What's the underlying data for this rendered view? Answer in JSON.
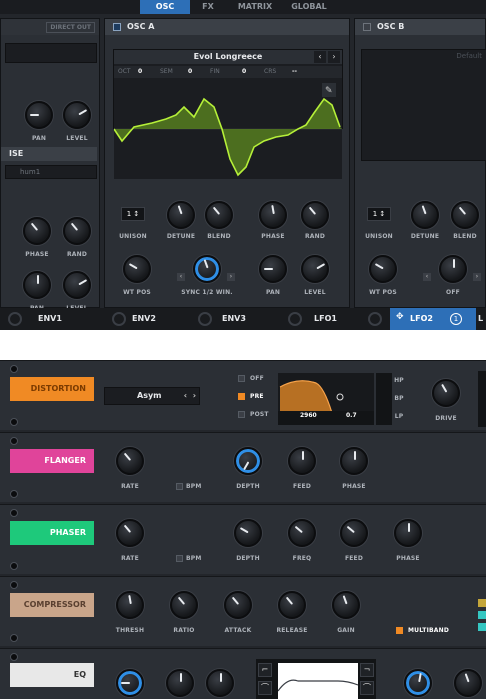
{
  "top": {
    "tabs": [
      {
        "label": "OSC",
        "active": true
      },
      {
        "label": "FX",
        "active": false
      },
      {
        "label": "MATRIX",
        "active": false
      },
      {
        "label": "GLOBAL",
        "active": false
      }
    ],
    "left_partial": {
      "direct_out": "DIRECT OUT",
      "pan": "PAN",
      "level": "LEVEL",
      "section_fragment": "ISE",
      "preset_fragment": "hum1",
      "phase": "PHASE",
      "rand": "RAND",
      "pan2": "PAN",
      "level2": "LEVEL"
    },
    "osc_a": {
      "title": "OSC A",
      "wavetable": "Evol Longreece",
      "oct_label": "OCT",
      "oct": "0",
      "sem_label": "SEM",
      "sem": "0",
      "fin_label": "FIN",
      "fin": "0",
      "crs_label": "CRS",
      "crs": "--",
      "unison_value": "1",
      "unison": "UNISON",
      "detune": "DETUNE",
      "blend": "BLEND",
      "phase": "PHASE",
      "rand": "RAND",
      "wt_pos": "WT POS",
      "sync": "SYNC 1/2 WIN.",
      "pan": "PAN",
      "level": "LEVEL"
    },
    "osc_b": {
      "title": "OSC B",
      "preset": "Default",
      "unison_value": "1",
      "unison": "UNISON",
      "detune": "DETUNE",
      "blend": "BLEND",
      "wt_pos": "WT POS",
      "off": "OFF"
    },
    "env_bar": {
      "env1": "ENV1",
      "env2": "ENV2",
      "env3": "ENV3",
      "lfo1": "LFO1",
      "lfo2": "LFO2",
      "lfo2_count": "1",
      "lfo_fragment": "L"
    }
  },
  "fx": {
    "distortion": {
      "label": "DISTORTION",
      "color": "#f08a24",
      "mode": "Asym",
      "off": "OFF",
      "pre": "PRE",
      "post": "POST",
      "freq": "2960",
      "q": "0.7",
      "hp": "HP",
      "bp": "BP",
      "lp": "LP",
      "drive": "DRIVE"
    },
    "flanger": {
      "label": "FLANGER",
      "color": "#e0449a",
      "rate": "RATE",
      "bpm": "BPM",
      "depth": "DEPTH",
      "feed": "FEED",
      "phase": "PHASE"
    },
    "phaser": {
      "label": "PHASER",
      "color": "#1ec97b",
      "rate": "RATE",
      "bpm": "BPM",
      "depth": "DEPTH",
      "freq": "FREQ",
      "feed": "FEED",
      "phase": "PHASE"
    },
    "compressor": {
      "label": "COMPRESSOR",
      "color": "#c9a58a",
      "thresh": "THRESH",
      "ratio": "RATIO",
      "attack": "ATTACK",
      "release": "RELEASE",
      "gain": "GAIN",
      "multiband": "MULTIBAND"
    },
    "eq": {
      "label": "EQ",
      "color": "#e8e8e8"
    }
  }
}
